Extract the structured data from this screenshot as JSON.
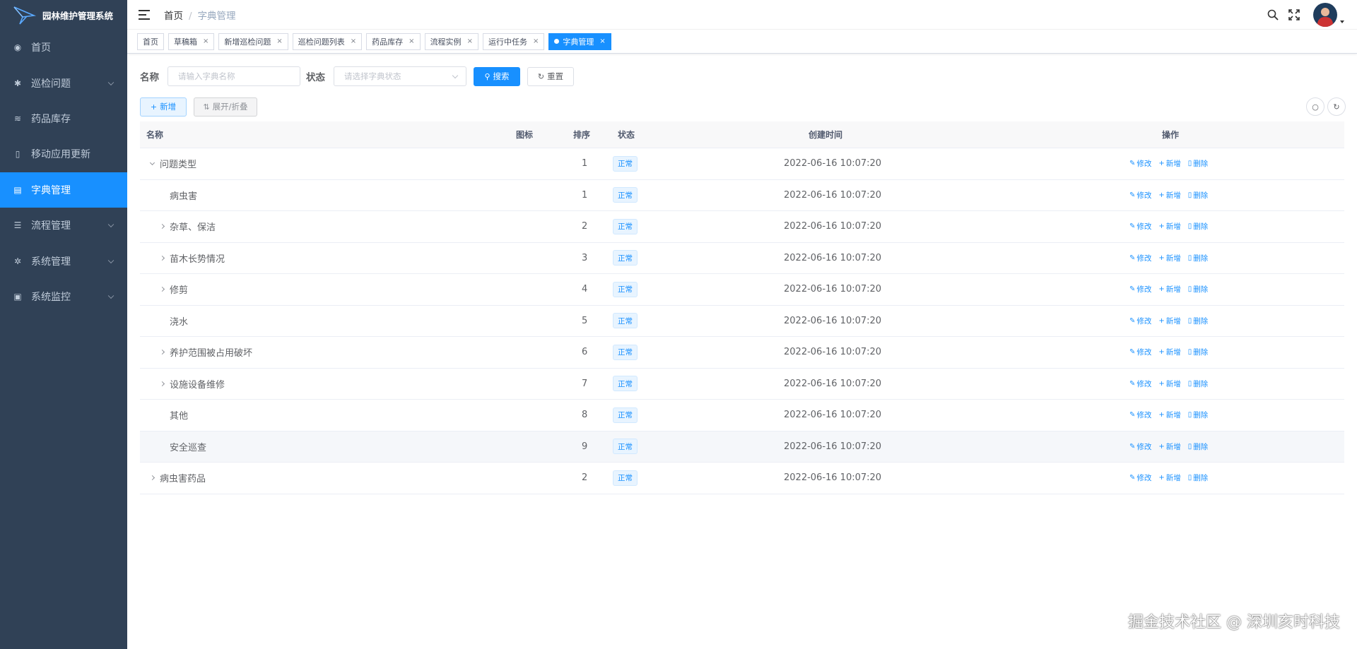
{
  "app": {
    "title": "园林维护管理系统"
  },
  "sidebar": {
    "items": [
      {
        "label": "首页",
        "icon": "dashboard-icon",
        "glyph": "◉",
        "active": false,
        "has_children": false
      },
      {
        "label": "巡检问题",
        "icon": "bug-icon",
        "glyph": "✱",
        "active": false,
        "has_children": true
      },
      {
        "label": "药品库存",
        "icon": "stack-icon",
        "glyph": "≋",
        "active": false,
        "has_children": false
      },
      {
        "label": "移动应用更新",
        "icon": "phone-icon",
        "glyph": "▯",
        "active": false,
        "has_children": false
      },
      {
        "label": "字典管理",
        "icon": "dict-icon",
        "glyph": "▤",
        "active": true,
        "has_children": false
      },
      {
        "label": "流程管理",
        "icon": "list-icon",
        "glyph": "☰",
        "active": false,
        "has_children": true
      },
      {
        "label": "系统管理",
        "icon": "gear-icon",
        "glyph": "✲",
        "active": false,
        "has_children": true
      },
      {
        "label": "系统监控",
        "icon": "monitor-icon",
        "glyph": "▣",
        "active": false,
        "has_children": true
      }
    ]
  },
  "breadcrumb": {
    "home": "首页",
    "current": "字典管理"
  },
  "tags": [
    {
      "label": "首页",
      "closable": false,
      "active": false
    },
    {
      "label": "草稿箱",
      "closable": true,
      "active": false
    },
    {
      "label": "新增巡检问题",
      "closable": true,
      "active": false
    },
    {
      "label": "巡检问题列表",
      "closable": true,
      "active": false
    },
    {
      "label": "药品库存",
      "closable": true,
      "active": false
    },
    {
      "label": "流程实例",
      "closable": true,
      "active": false
    },
    {
      "label": "运行中任务",
      "closable": true,
      "active": false
    },
    {
      "label": "字典管理",
      "closable": true,
      "active": true
    }
  ],
  "search": {
    "name_label": "名称",
    "name_placeholder": "请输入字典名称",
    "status_label": "状态",
    "status_placeholder": "请选择字典状态",
    "search_button": "搜索",
    "reset_button": "重置"
  },
  "toolbar": {
    "add_button": "新增",
    "expand_button": "展开/折叠"
  },
  "table": {
    "headers": {
      "name": "名称",
      "icon": "图标",
      "sort": "排序",
      "status": "状态",
      "created": "创建时间",
      "actions": "操作"
    },
    "actions": {
      "edit": "修改",
      "add": "新增",
      "delete": "删除"
    },
    "rows": [
      {
        "name": "问题类型",
        "level": 0,
        "expander": "open",
        "sort": "1",
        "status": "正常",
        "created": "2022-06-16 10:07:20",
        "highlight": false
      },
      {
        "name": "病虫害",
        "level": 1,
        "expander": "none",
        "sort": "1",
        "status": "正常",
        "created": "2022-06-16 10:07:20",
        "highlight": false
      },
      {
        "name": "杂草、保洁",
        "level": 1,
        "expander": "closed",
        "sort": "2",
        "status": "正常",
        "created": "2022-06-16 10:07:20",
        "highlight": false
      },
      {
        "name": "苗木长势情况",
        "level": 1,
        "expander": "closed",
        "sort": "3",
        "status": "正常",
        "created": "2022-06-16 10:07:20",
        "highlight": false
      },
      {
        "name": "修剪",
        "level": 1,
        "expander": "closed",
        "sort": "4",
        "status": "正常",
        "created": "2022-06-16 10:07:20",
        "highlight": false
      },
      {
        "name": "浇水",
        "level": 1,
        "expander": "none",
        "sort": "5",
        "status": "正常",
        "created": "2022-06-16 10:07:20",
        "highlight": false
      },
      {
        "name": "养护范围被占用破坏",
        "level": 1,
        "expander": "closed",
        "sort": "6",
        "status": "正常",
        "created": "2022-06-16 10:07:20",
        "highlight": false
      },
      {
        "name": "设施设备维修",
        "level": 1,
        "expander": "closed",
        "sort": "7",
        "status": "正常",
        "created": "2022-06-16 10:07:20",
        "highlight": false
      },
      {
        "name": "其他",
        "level": 1,
        "expander": "none",
        "sort": "8",
        "status": "正常",
        "created": "2022-06-16 10:07:20",
        "highlight": false
      },
      {
        "name": "安全巡查",
        "level": 1,
        "expander": "none",
        "sort": "9",
        "status": "正常",
        "created": "2022-06-16 10:07:20",
        "highlight": true
      },
      {
        "name": "病虫害药品",
        "level": 0,
        "expander": "closed",
        "sort": "2",
        "status": "正常",
        "created": "2022-06-16 10:07:20",
        "highlight": false
      }
    ]
  },
  "watermark": "掘金技术社区 @ 深圳亥时科技",
  "colors": {
    "sidebar_bg": "#304156",
    "primary": "#1890ff",
    "sidebar_text": "#bfcbd9"
  }
}
